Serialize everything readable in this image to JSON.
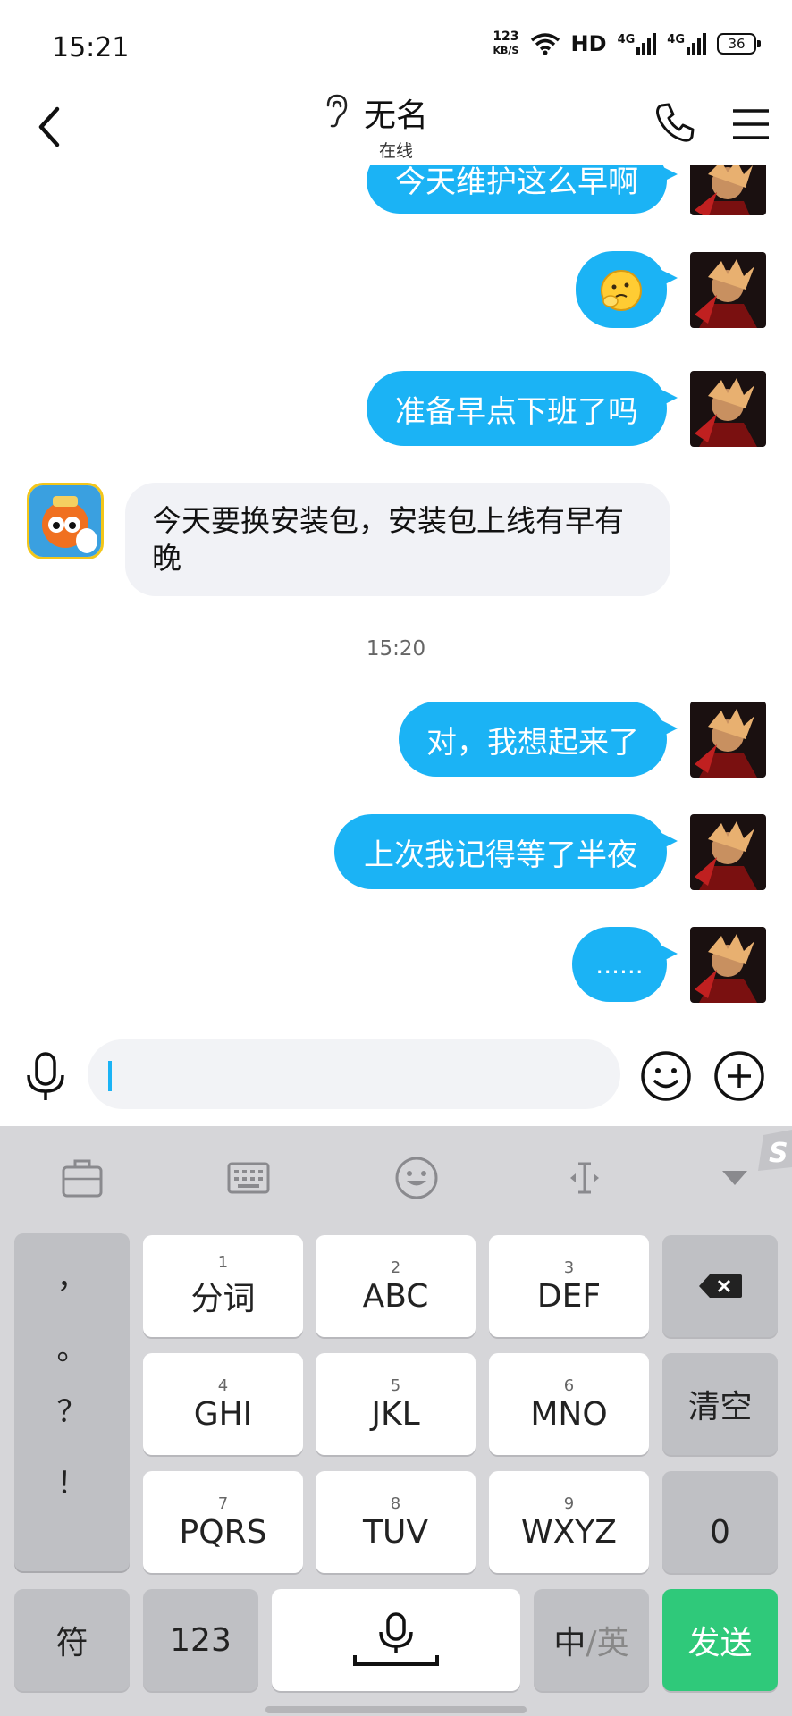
{
  "status_bar": {
    "time": "15:21",
    "net_speed_value": "123",
    "net_speed_unit": "KB/S",
    "hd_label": "HD",
    "signal1_label": "4G",
    "signal2_label": "4G",
    "battery": "36"
  },
  "header": {
    "title": "无名",
    "subtitle": "在线"
  },
  "messages": [
    {
      "text": "今天维护这么早啊",
      "from": "me"
    },
    {
      "text": "",
      "from": "me",
      "type": "sticker"
    },
    {
      "text": "准备早点下班了吗",
      "from": "me"
    },
    {
      "text": "今天要换安装包，安装包上线有早有晚",
      "from": "other"
    },
    {
      "text": "对，我想起来了",
      "from": "me"
    },
    {
      "text": "上次我记得等了半夜",
      "from": "me"
    },
    {
      "text": "......",
      "from": "me"
    }
  ],
  "time_divider": "15:20",
  "input": {
    "value": "",
    "placeholder": ""
  },
  "keyboard": {
    "punctuation": [
      "，",
      "。",
      "？",
      "！"
    ],
    "row1": [
      {
        "num": "1",
        "label": "分词"
      },
      {
        "num": "2",
        "label": "ABC"
      },
      {
        "num": "3",
        "label": "DEF"
      }
    ],
    "row2": [
      {
        "num": "4",
        "label": "GHI"
      },
      {
        "num": "5",
        "label": "JKL"
      },
      {
        "num": "6",
        "label": "MNO"
      }
    ],
    "row3": [
      {
        "num": "7",
        "label": "PQRS"
      },
      {
        "num": "8",
        "label": "TUV"
      },
      {
        "num": "9",
        "label": "WXYZ"
      }
    ],
    "clear_label": "清空",
    "zero_label": "0",
    "symbol_label": "符",
    "numeric_label": "123",
    "lang_zh": "中",
    "lang_sep": "/",
    "lang_en": "英",
    "send_label": "发送"
  },
  "colors": {
    "bubble_out": "#1bb3f5",
    "bubble_in": "#f1f2f6",
    "send_key": "#2fc97a",
    "keyboard_bg": "#d6d6d9"
  }
}
